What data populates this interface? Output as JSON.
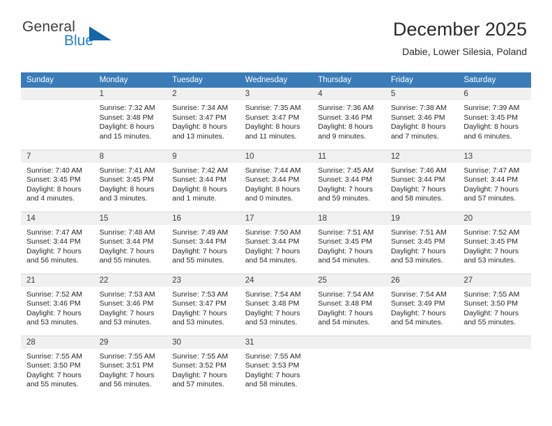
{
  "brand": {
    "name_top": "General",
    "name_bottom": "Blue",
    "color_dark": "#3c3c3c",
    "color_blue": "#1f7fd0",
    "triangle_color": "#1565a8"
  },
  "header": {
    "title": "December 2025",
    "subtitle": "Dabie, Lower Silesia, Poland"
  },
  "theme": {
    "header_row_bg": "#3b7cb8",
    "header_row_text": "#ffffff",
    "daynum_bg": "#f0f0f0",
    "cell_bg": "#ffffff",
    "grid_line": "#d9d9d9"
  },
  "weekdays": [
    "Sunday",
    "Monday",
    "Tuesday",
    "Wednesday",
    "Thursday",
    "Friday",
    "Saturday"
  ],
  "weeks": [
    [
      {
        "day": "",
        "blank": true,
        "sunrise": "",
        "sunset": "",
        "daylight_line1": "",
        "daylight_line2": ""
      },
      {
        "day": "1",
        "sunrise": "Sunrise: 7:32 AM",
        "sunset": "Sunset: 3:48 PM",
        "daylight_line1": "Daylight: 8 hours",
        "daylight_line2": "and 15 minutes."
      },
      {
        "day": "2",
        "sunrise": "Sunrise: 7:34 AM",
        "sunset": "Sunset: 3:47 PM",
        "daylight_line1": "Daylight: 8 hours",
        "daylight_line2": "and 13 minutes."
      },
      {
        "day": "3",
        "sunrise": "Sunrise: 7:35 AM",
        "sunset": "Sunset: 3:47 PM",
        "daylight_line1": "Daylight: 8 hours",
        "daylight_line2": "and 11 minutes."
      },
      {
        "day": "4",
        "sunrise": "Sunrise: 7:36 AM",
        "sunset": "Sunset: 3:46 PM",
        "daylight_line1": "Daylight: 8 hours",
        "daylight_line2": "and 9 minutes."
      },
      {
        "day": "5",
        "sunrise": "Sunrise: 7:38 AM",
        "sunset": "Sunset: 3:46 PM",
        "daylight_line1": "Daylight: 8 hours",
        "daylight_line2": "and 7 minutes."
      },
      {
        "day": "6",
        "sunrise": "Sunrise: 7:39 AM",
        "sunset": "Sunset: 3:45 PM",
        "daylight_line1": "Daylight: 8 hours",
        "daylight_line2": "and 6 minutes."
      }
    ],
    [
      {
        "day": "7",
        "sunrise": "Sunrise: 7:40 AM",
        "sunset": "Sunset: 3:45 PM",
        "daylight_line1": "Daylight: 8 hours",
        "daylight_line2": "and 4 minutes."
      },
      {
        "day": "8",
        "sunrise": "Sunrise: 7:41 AM",
        "sunset": "Sunset: 3:45 PM",
        "daylight_line1": "Daylight: 8 hours",
        "daylight_line2": "and 3 minutes."
      },
      {
        "day": "9",
        "sunrise": "Sunrise: 7:42 AM",
        "sunset": "Sunset: 3:44 PM",
        "daylight_line1": "Daylight: 8 hours",
        "daylight_line2": "and 1 minute."
      },
      {
        "day": "10",
        "sunrise": "Sunrise: 7:44 AM",
        "sunset": "Sunset: 3:44 PM",
        "daylight_line1": "Daylight: 8 hours",
        "daylight_line2": "and 0 minutes."
      },
      {
        "day": "11",
        "sunrise": "Sunrise: 7:45 AM",
        "sunset": "Sunset: 3:44 PM",
        "daylight_line1": "Daylight: 7 hours",
        "daylight_line2": "and 59 minutes."
      },
      {
        "day": "12",
        "sunrise": "Sunrise: 7:46 AM",
        "sunset": "Sunset: 3:44 PM",
        "daylight_line1": "Daylight: 7 hours",
        "daylight_line2": "and 58 minutes."
      },
      {
        "day": "13",
        "sunrise": "Sunrise: 7:47 AM",
        "sunset": "Sunset: 3:44 PM",
        "daylight_line1": "Daylight: 7 hours",
        "daylight_line2": "and 57 minutes."
      }
    ],
    [
      {
        "day": "14",
        "sunrise": "Sunrise: 7:47 AM",
        "sunset": "Sunset: 3:44 PM",
        "daylight_line1": "Daylight: 7 hours",
        "daylight_line2": "and 56 minutes."
      },
      {
        "day": "15",
        "sunrise": "Sunrise: 7:48 AM",
        "sunset": "Sunset: 3:44 PM",
        "daylight_line1": "Daylight: 7 hours",
        "daylight_line2": "and 55 minutes."
      },
      {
        "day": "16",
        "sunrise": "Sunrise: 7:49 AM",
        "sunset": "Sunset: 3:44 PM",
        "daylight_line1": "Daylight: 7 hours",
        "daylight_line2": "and 55 minutes."
      },
      {
        "day": "17",
        "sunrise": "Sunrise: 7:50 AM",
        "sunset": "Sunset: 3:44 PM",
        "daylight_line1": "Daylight: 7 hours",
        "daylight_line2": "and 54 minutes."
      },
      {
        "day": "18",
        "sunrise": "Sunrise: 7:51 AM",
        "sunset": "Sunset: 3:45 PM",
        "daylight_line1": "Daylight: 7 hours",
        "daylight_line2": "and 54 minutes."
      },
      {
        "day": "19",
        "sunrise": "Sunrise: 7:51 AM",
        "sunset": "Sunset: 3:45 PM",
        "daylight_line1": "Daylight: 7 hours",
        "daylight_line2": "and 53 minutes."
      },
      {
        "day": "20",
        "sunrise": "Sunrise: 7:52 AM",
        "sunset": "Sunset: 3:45 PM",
        "daylight_line1": "Daylight: 7 hours",
        "daylight_line2": "and 53 minutes."
      }
    ],
    [
      {
        "day": "21",
        "sunrise": "Sunrise: 7:52 AM",
        "sunset": "Sunset: 3:46 PM",
        "daylight_line1": "Daylight: 7 hours",
        "daylight_line2": "and 53 minutes."
      },
      {
        "day": "22",
        "sunrise": "Sunrise: 7:53 AM",
        "sunset": "Sunset: 3:46 PM",
        "daylight_line1": "Daylight: 7 hours",
        "daylight_line2": "and 53 minutes."
      },
      {
        "day": "23",
        "sunrise": "Sunrise: 7:53 AM",
        "sunset": "Sunset: 3:47 PM",
        "daylight_line1": "Daylight: 7 hours",
        "daylight_line2": "and 53 minutes."
      },
      {
        "day": "24",
        "sunrise": "Sunrise: 7:54 AM",
        "sunset": "Sunset: 3:48 PM",
        "daylight_line1": "Daylight: 7 hours",
        "daylight_line2": "and 53 minutes."
      },
      {
        "day": "25",
        "sunrise": "Sunrise: 7:54 AM",
        "sunset": "Sunset: 3:48 PM",
        "daylight_line1": "Daylight: 7 hours",
        "daylight_line2": "and 54 minutes."
      },
      {
        "day": "26",
        "sunrise": "Sunrise: 7:54 AM",
        "sunset": "Sunset: 3:49 PM",
        "daylight_line1": "Daylight: 7 hours",
        "daylight_line2": "and 54 minutes."
      },
      {
        "day": "27",
        "sunrise": "Sunrise: 7:55 AM",
        "sunset": "Sunset: 3:50 PM",
        "daylight_line1": "Daylight: 7 hours",
        "daylight_line2": "and 55 minutes."
      }
    ],
    [
      {
        "day": "28",
        "sunrise": "Sunrise: 7:55 AM",
        "sunset": "Sunset: 3:50 PM",
        "daylight_line1": "Daylight: 7 hours",
        "daylight_line2": "and 55 minutes."
      },
      {
        "day": "29",
        "sunrise": "Sunrise: 7:55 AM",
        "sunset": "Sunset: 3:51 PM",
        "daylight_line1": "Daylight: 7 hours",
        "daylight_line2": "and 56 minutes."
      },
      {
        "day": "30",
        "sunrise": "Sunrise: 7:55 AM",
        "sunset": "Sunset: 3:52 PM",
        "daylight_line1": "Daylight: 7 hours",
        "daylight_line2": "and 57 minutes."
      },
      {
        "day": "31",
        "sunrise": "Sunrise: 7:55 AM",
        "sunset": "Sunset: 3:53 PM",
        "daylight_line1": "Daylight: 7 hours",
        "daylight_line2": "and 58 minutes."
      },
      {
        "day": "",
        "blank": true,
        "sunrise": "",
        "sunset": "",
        "daylight_line1": "",
        "daylight_line2": ""
      },
      {
        "day": "",
        "blank": true,
        "sunrise": "",
        "sunset": "",
        "daylight_line1": "",
        "daylight_line2": ""
      },
      {
        "day": "",
        "blank": true,
        "sunrise": "",
        "sunset": "",
        "daylight_line1": "",
        "daylight_line2": ""
      }
    ]
  ]
}
